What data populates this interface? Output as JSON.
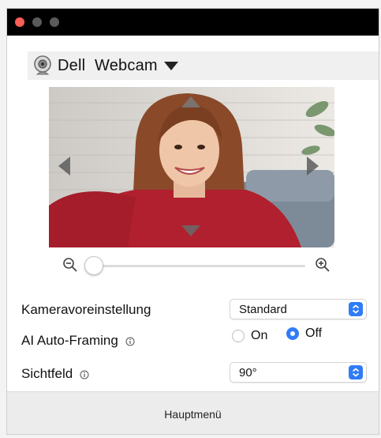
{
  "window": {
    "traffic_lights": [
      "close",
      "minimize",
      "maximize"
    ],
    "close_color": "#fe5f57"
  },
  "device": {
    "icon": "webcam-icon",
    "name": "Dell  Webcam",
    "dropdown_icon": "caret-down-icon"
  },
  "preview": {
    "pan_icons": [
      "pan-up-arrow-icon",
      "pan-down-arrow-icon",
      "pan-left-arrow-icon",
      "pan-right-arrow-icon"
    ]
  },
  "zoom": {
    "out_icon": "zoom-out-icon",
    "in_icon": "zoom-in-icon",
    "level": 0
  },
  "settings": {
    "preset": {
      "label": "Kameravoreinstellung",
      "value": "Standard"
    },
    "autoframing": {
      "label": "AI Auto-Framing",
      "info_icon": "info-icon",
      "options": [
        {
          "label": "On",
          "selected": false
        },
        {
          "label": "Off",
          "selected": true
        }
      ]
    },
    "fov": {
      "label": "Sichtfeld",
      "info_icon": "info-icon",
      "value": "90°"
    }
  },
  "footer": {
    "main_menu": "Hauptmenü"
  },
  "colors": {
    "accent": "#2f7cf6",
    "titlebar": "#000000"
  }
}
